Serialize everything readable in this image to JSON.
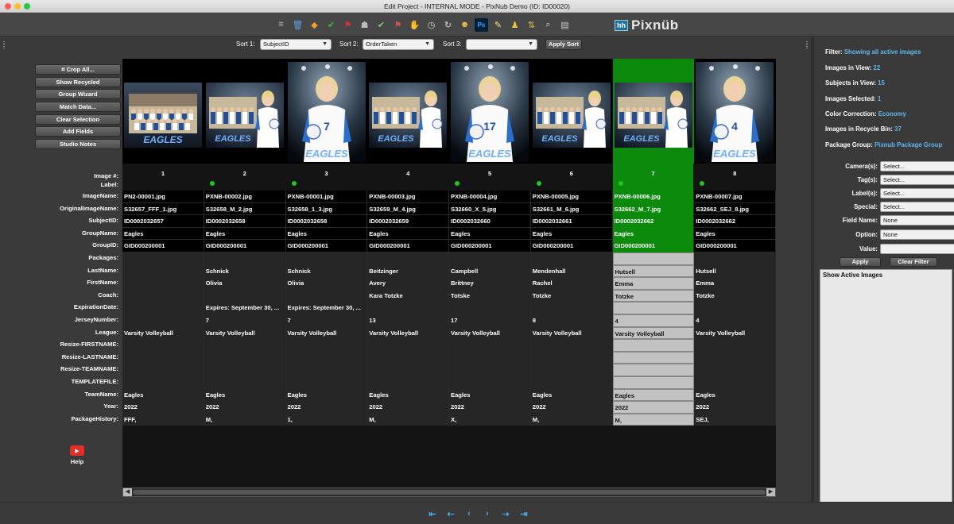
{
  "window": {
    "title": "Edit Project - INTERNAL MODE - PixNub Demo (ID: ID00020)"
  },
  "toolbar": {
    "icons": [
      "crop-icon",
      "trash-icon",
      "tag-icon",
      "check-icon",
      "flag-icon",
      "users-icon",
      "group-check-icon",
      "group-flag-icon",
      "hand-icon",
      "clock-icon",
      "refresh-icon",
      "people-icon",
      "photoshop-icon",
      "edit-icon",
      "person-icon",
      "sort-icon",
      "search-icon",
      "page-icon"
    ],
    "logo_hh": "hh",
    "logo_text": "Pixnüb"
  },
  "sort": {
    "sort1_label": "Sort 1:",
    "sort1_value": "SubjectID",
    "sort2_label": "Sort 2:",
    "sort2_value": "OrderTaken",
    "sort3_label": "Sort 3:",
    "sort3_value": "",
    "apply_label": "Apply Sort"
  },
  "left_buttons": {
    "crop_all": "⌗ Crop All...",
    "show_recycled": "Show Recycled",
    "group_wizard": "Group Wizard",
    "match_data": "Match Data...",
    "clear_selection": "Clear Selection",
    "add_fields": "Add Fields",
    "studio_notes": "Studio Notes",
    "help": "Help"
  },
  "row_labels": {
    "image_num": "Image #:",
    "label": "Label:",
    "rows": [
      "ImageName:",
      "OriginalImageName:",
      "SubjectID:",
      "GroupName:",
      "GroupID:",
      "Packages:",
      "LastName:",
      "FirstName:",
      "Coach:",
      "ExpirationDate:",
      "JerseyNumber:",
      "League:",
      "Resize-FIRSTNAME:",
      "Resize-LASTNAME:",
      "Resize-TEAMNAME:",
      "TEMPLATEFILE:",
      "TeamName:",
      "Year:",
      "PackageHistory:"
    ]
  },
  "images": [
    {
      "num": "1",
      "dot": false,
      "type": "group",
      "selected": false,
      "values": [
        "PN2-00001.jpg",
        "S32657_FFF_1.jpg",
        "ID0002032657",
        "Eagles",
        "GID000200001",
        "",
        "",
        "",
        "",
        "",
        "",
        "Varsity Volleyball",
        "",
        "",
        "",
        "",
        "Eagles",
        "2022",
        "FFF,"
      ]
    },
    {
      "num": "2",
      "dot": true,
      "type": "group2",
      "selected": false,
      "values": [
        "PXNB-00002.jpg",
        "S32658_M_2.jpg",
        "ID0002032658",
        "Eagles",
        "GID000200001",
        "",
        "Schnick",
        "Olivia",
        "",
        "Expires: September 30, ...",
        "7",
        "Varsity Volleyball",
        "",
        "",
        "",
        "",
        "Eagles",
        "2022",
        "M,"
      ]
    },
    {
      "num": "3",
      "dot": true,
      "type": "single",
      "selected": false,
      "values": [
        "PXNB-00001.jpg",
        "S32658_1_3.jpg",
        "ID0002032658",
        "Eagles",
        "GID000200001",
        "",
        "Schnick",
        "Olivia",
        "",
        "Expires: September 30, ...",
        "7",
        "Varsity Volleyball",
        "",
        "",
        "",
        "",
        "Eagles",
        "2022",
        "1,"
      ]
    },
    {
      "num": "4",
      "dot": false,
      "type": "group2",
      "selected": false,
      "values": [
        "PXNB-00003.jpg",
        "S32659_M_4.jpg",
        "ID0002032659",
        "Eagles",
        "GID000200001",
        "",
        "Beitzinger",
        "Avery",
        "Kara Totzke",
        "",
        "13",
        "Varsity Volleyball",
        "",
        "",
        "",
        "",
        "Eagles",
        "2022",
        "M,"
      ]
    },
    {
      "num": "5",
      "dot": true,
      "type": "single",
      "selected": false,
      "values": [
        "PXNB-00004.jpg",
        "S32660_X_5.jpg",
        "ID0002032660",
        "Eagles",
        "GID000200001",
        "",
        "Campbell",
        "Brittney",
        "Totske",
        "",
        "17",
        "Varsity Volleyball",
        "",
        "",
        "",
        "",
        "Eagles",
        "2022",
        "X,"
      ]
    },
    {
      "num": "6",
      "dot": true,
      "type": "group2",
      "selected": false,
      "values": [
        "PXNB-00005.jpg",
        "S32661_M_6.jpg",
        "ID0002032661",
        "Eagles",
        "GID000200001",
        "",
        "Mendenhall",
        "Rachel",
        "Totzke",
        "",
        "8",
        "Varsity Volleyball",
        "",
        "",
        "",
        "",
        "Eagles",
        "2022",
        "M,"
      ]
    },
    {
      "num": "7",
      "dot": true,
      "type": "group2",
      "selected": true,
      "values": [
        "PXNB-00006.jpg",
        "S32662_M_7.jpg",
        "ID0002032662",
        "Eagles",
        "GID000200001",
        "",
        "Hutsell",
        "Emma",
        "Totzke",
        "",
        "4",
        "Varsity Volleyball",
        "",
        "",
        "",
        "",
        "Eagles",
        "2022",
        "M,"
      ]
    },
    {
      "num": "8",
      "dot": true,
      "type": "single",
      "selected": false,
      "values": [
        "PXNB-00007.jpg",
        "S32662_SEJ_8.jpg",
        "ID0002032662",
        "Eagles",
        "GID000200001",
        "",
        "Hutsell",
        "Emma",
        "Totzke",
        "",
        "4",
        "Varsity Volleyball",
        "",
        "",
        "",
        "",
        "Eagles",
        "2022",
        "SEJ,"
      ]
    }
  ],
  "right_panel": {
    "filter_label": "Filter:",
    "filter_value": "Showing all active images",
    "images_in_view_label": "Images in View:",
    "images_in_view": "22",
    "subjects_in_view_label": "Subjects in View:",
    "subjects_in_view": "15",
    "images_selected_label": "Images Selected:",
    "images_selected": "1",
    "color_correction_label": "Color Correction:",
    "color_correction": "Economy",
    "recycle_label": "Images in Recycle Bin:",
    "recycle": "37",
    "package_group_label": "Package Group:",
    "package_group": "Pixnub Package Group",
    "cameras_label": "Camera(s):",
    "cameras": "Select...",
    "tags_label": "Tag(s):",
    "tags": "Select...",
    "labels_label": "Label(s):",
    "labels": "Select...",
    "special_label": "Special:",
    "special": "Select...",
    "field_name_label": "Field Name:",
    "field_name": "None",
    "option_label": "Option:",
    "option": "None",
    "value_label": "Value:",
    "value": "",
    "apply": "Apply",
    "clear_filter": "Clear Filter",
    "result": "Show Active Images"
  },
  "nav": {
    "first": "⇤",
    "prev_page": "⇠",
    "prev": "‹",
    "next": "›",
    "next_page": "⇢",
    "last": "⇥"
  },
  "colors": {
    "selected_green": "#0b8a0b",
    "link_blue": "#5fb7ef",
    "dot_green": "#1ec81e"
  }
}
